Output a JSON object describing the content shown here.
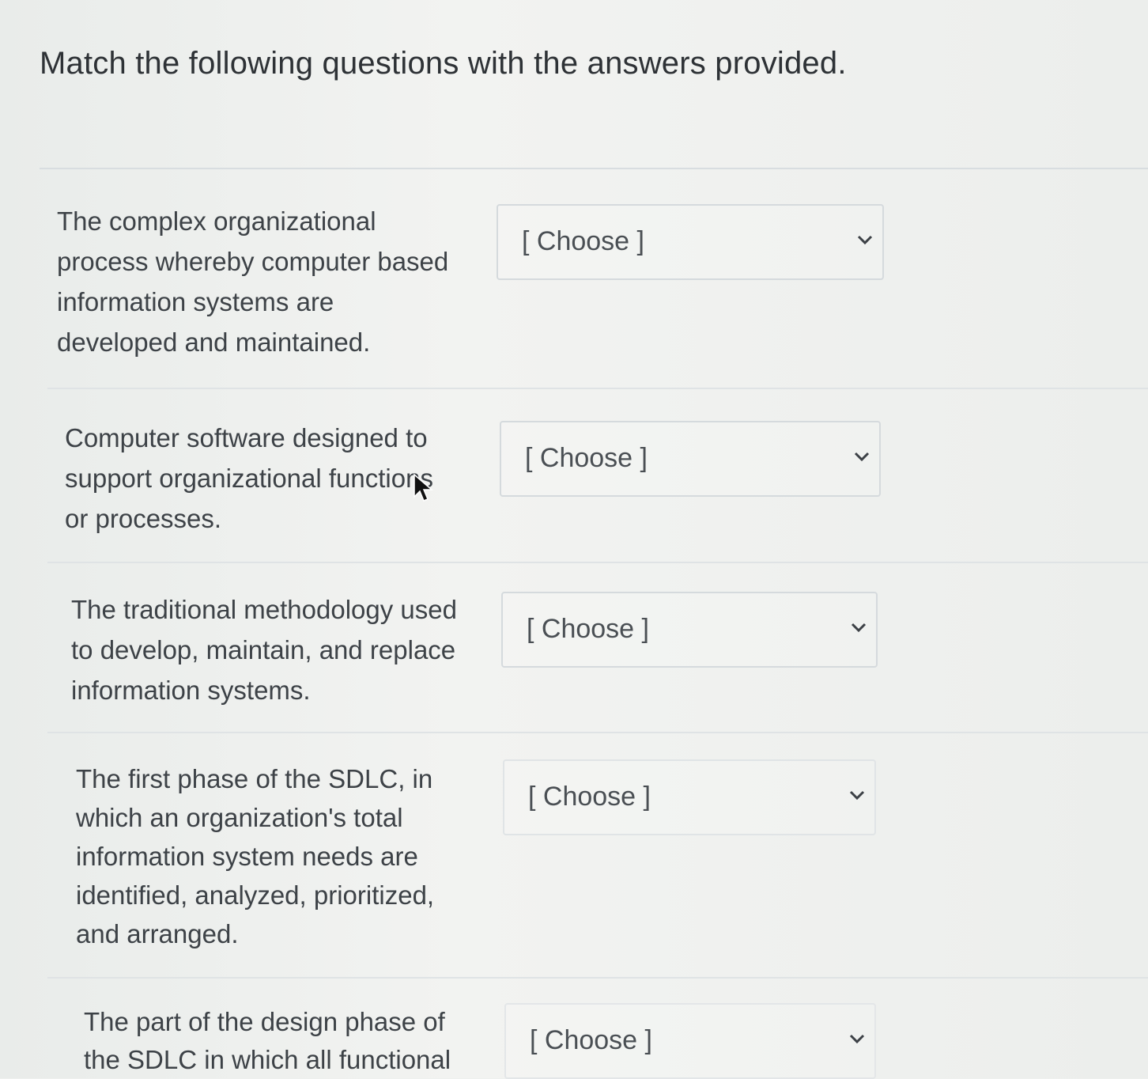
{
  "instructions": "Match the following questions with the answers provided.",
  "rows": [
    {
      "question": "The complex organizational\nprocess whereby computer based\ninformation systems are\ndeveloped and maintained.",
      "selected": "[ Choose ]"
    },
    {
      "question": "Computer software designed to\nsupport organizational functions\nor processes.",
      "selected": "[ Choose ]"
    },
    {
      "question": "The traditional methodology used\nto develop, maintain, and replace\ninformation systems.",
      "selected": "[ Choose ]"
    },
    {
      "question": "The first phase of the SDLC, in\nwhich an organization's total\ninformation system needs are\nidentified, analyzed, prioritized,\nand arranged.",
      "selected": "[ Choose ]"
    },
    {
      "question": "The part of the design phase of\nthe SDLC in which all functional",
      "selected": "[ Choose ]"
    }
  ],
  "icons": {
    "dropdown": "chevron-down-icon",
    "pointer": "mouse-cursor-icon"
  }
}
